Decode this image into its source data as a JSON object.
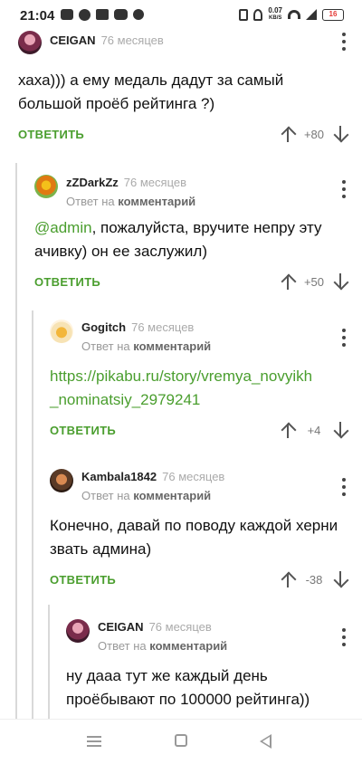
{
  "status_bar": {
    "time": "21:04",
    "net_speed": "0.07",
    "net_unit": "KB/S",
    "battery": "16"
  },
  "comments": [
    {
      "author": "CEIGAN",
      "ago": "76 месяцев",
      "text": "хаха))) а ему медаль дадут за самый большой проёб рейтинга ?)",
      "answer_label": "ОТВЕТИТЬ",
      "score": "+80"
    },
    {
      "author": "zZDarkZz",
      "ago": "76 месяцев",
      "reply_prefix": "Ответ на",
      "reply_target": "комментарий",
      "mention": "@admin",
      "text": ", пожалуйста, вручите непру эту ачивку) он ее заслужил)",
      "answer_label": "ОТВЕТИТЬ",
      "score": "+50"
    },
    {
      "author": "Gogitch",
      "ago": "76 месяцев",
      "reply_prefix": "Ответ на",
      "reply_target": "комментарий",
      "link_line1": "https://pikabu.ru/story/vremya_novyikh",
      "link_line2": "_nominatsiy_2979241",
      "answer_label": "ОТВЕТИТЬ",
      "score": "+4"
    },
    {
      "author": "Kambala1842",
      "ago": "76 месяцев",
      "reply_prefix": "Ответ на",
      "reply_target": "комментарий",
      "text": "Конечно, давай по поводу каждой херни звать админа)",
      "answer_label": "ОТВЕТИТЬ",
      "score": "-38"
    },
    {
      "author": "CEIGAN",
      "ago": "76 месяцев",
      "reply_prefix": "Ответ на",
      "reply_target": "комментарий",
      "text": "ну дааа  тут же каждый день проёбывают по 100000 рейтинга))"
    }
  ],
  "colors": {
    "accent": "#4a9e2e",
    "thread_line": "#d9d9d9"
  },
  "icons": [
    "menu-icon",
    "home-icon",
    "back-icon",
    "more-vert-icon",
    "arrow-up-icon",
    "arrow-down-icon"
  ]
}
